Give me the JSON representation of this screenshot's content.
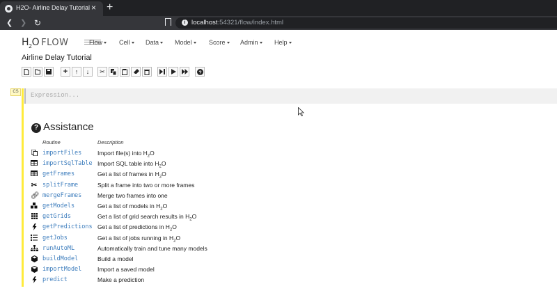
{
  "browser": {
    "tab_title": "H2O- Airline Delay Tutorial",
    "tab_close": "×",
    "new_tab": "+",
    "back": "❮",
    "forward": "❯",
    "reload": "↻",
    "url_host": "localhost",
    "url_rest": ":54321/flow/index.html"
  },
  "app": {
    "logo_prefix": "H",
    "logo_sub": "2",
    "logo_suffix": "O",
    "logo_flow": "FLOW",
    "menu": [
      "Flow",
      "Cell",
      "Data",
      "Model",
      "Score",
      "Admin",
      "Help"
    ],
    "notebook_title": "Airline Delay Tutorial"
  },
  "toolbar_icons": [
    "new-file",
    "open-folder",
    "save",
    "insert-cell",
    "move-up",
    "move-down",
    "cut",
    "copy",
    "paste",
    "clear-output",
    "delete-cell",
    "run-to-here",
    "run",
    "run-all",
    "help"
  ],
  "cell": {
    "type_label": "CS",
    "placeholder": "Expression..."
  },
  "assistance": {
    "title": "Assistance",
    "col_routine": "Routine",
    "col_description": "Description",
    "rows": [
      {
        "icon": "copy-icon",
        "routine": "importFiles",
        "desc_pre": "Import file(s) into H",
        "h2o": true
      },
      {
        "icon": "table-icon",
        "routine": "importSqlTable",
        "desc_pre": "Import SQL table into H",
        "h2o": true
      },
      {
        "icon": "table-icon",
        "routine": "getFrames",
        "desc_pre": "Get a list of frames in H",
        "h2o": true
      },
      {
        "icon": "scissors-icon",
        "routine": "splitFrame",
        "desc_pre": "Split a frame into two or more frames",
        "h2o": false
      },
      {
        "icon": "link-icon",
        "routine": "mergeFrames",
        "desc_pre": "Merge two frames into one",
        "h2o": false
      },
      {
        "icon": "cubes-icon",
        "routine": "getModels",
        "desc_pre": "Get a list of models in H",
        "h2o": true
      },
      {
        "icon": "grid-icon",
        "routine": "getGrids",
        "desc_pre": "Get a list of grid search results in H",
        "h2o": true
      },
      {
        "icon": "bolt-icon",
        "routine": "getPredictions",
        "desc_pre": "Get a list of predictions in H",
        "h2o": true
      },
      {
        "icon": "list-icon",
        "routine": "getJobs",
        "desc_pre": "Get a list of jobs running in H",
        "h2o": true
      },
      {
        "icon": "sitemap-icon",
        "routine": "runAutoML",
        "desc_pre": "Automatically train and tune many models",
        "h2o": false
      },
      {
        "icon": "cube-icon",
        "routine": "buildModel",
        "desc_pre": "Build a model",
        "h2o": false
      },
      {
        "icon": "cube-icon",
        "routine": "importModel",
        "desc_pre": "Import a saved model",
        "h2o": false
      },
      {
        "icon": "bolt-icon",
        "routine": "predict",
        "desc_pre": "Make a prediction",
        "h2o": false
      }
    ]
  }
}
